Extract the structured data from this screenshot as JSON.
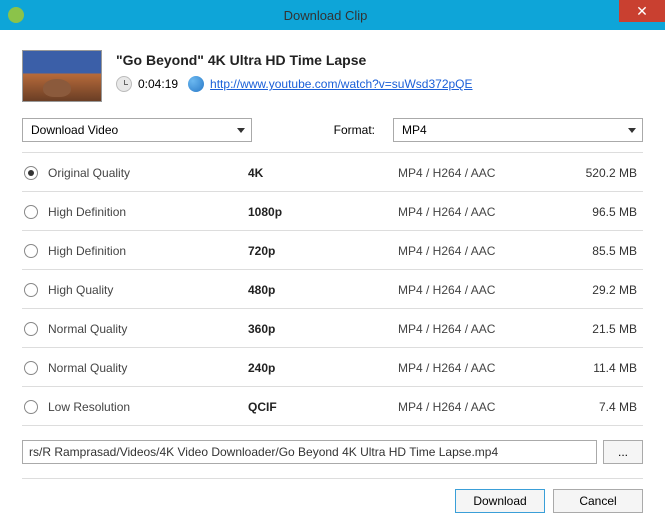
{
  "window": {
    "title": "Download Clip"
  },
  "video": {
    "title": "\"Go Beyond\" 4K Ultra HD Time Lapse",
    "duration": "0:04:19",
    "url": "http://www.youtube.com/watch?v=suWsd372pQE"
  },
  "controls": {
    "action": "Download Video",
    "format_label": "Format:",
    "format_value": "MP4"
  },
  "qualities": [
    {
      "selected": true,
      "name": "Original Quality",
      "res": "4K",
      "codec": "MP4 / H264 / AAC",
      "size": "520.2 MB"
    },
    {
      "selected": false,
      "name": "High Definition",
      "res": "1080p",
      "codec": "MP4 / H264 / AAC",
      "size": "96.5 MB"
    },
    {
      "selected": false,
      "name": "High Definition",
      "res": "720p",
      "codec": "MP4 / H264 / AAC",
      "size": "85.5 MB"
    },
    {
      "selected": false,
      "name": "High Quality",
      "res": "480p",
      "codec": "MP4 / H264 / AAC",
      "size": "29.2 MB"
    },
    {
      "selected": false,
      "name": "Normal Quality",
      "res": "360p",
      "codec": "MP4 / H264 / AAC",
      "size": "21.5 MB"
    },
    {
      "selected": false,
      "name": "Normal Quality",
      "res": "240p",
      "codec": "MP4 / H264 / AAC",
      "size": "11.4 MB"
    },
    {
      "selected": false,
      "name": "Low Resolution",
      "res": "QCIF",
      "codec": "MP4 / H264 / AAC",
      "size": "7.4 MB"
    }
  ],
  "path": {
    "value": "rs/R Ramprasad/Videos/4K Video Downloader/Go Beyond  4K Ultra HD Time Lapse.mp4",
    "browse": "..."
  },
  "buttons": {
    "download": "Download",
    "cancel": "Cancel"
  }
}
